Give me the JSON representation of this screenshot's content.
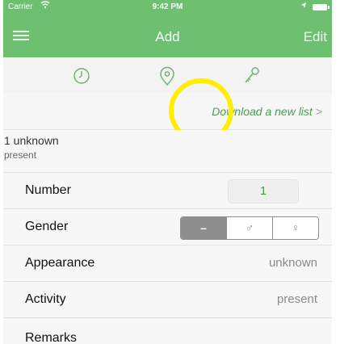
{
  "status_bar": {
    "carrier": "Carrier",
    "time": "9:42 PM"
  },
  "nav": {
    "title": "Add",
    "edit_label": "Edit",
    "menu_icon": "hamburger-menu-icon"
  },
  "tabs": [
    {
      "icon": "clock-icon"
    },
    {
      "icon": "location-pin-icon"
    },
    {
      "icon": "key-icon"
    }
  ],
  "download_link": {
    "label": "Download a new list",
    "chevron": ">"
  },
  "summary": {
    "line1": "1 unknown",
    "line2": "present"
  },
  "form": {
    "number": {
      "label": "Number",
      "value": "1"
    },
    "gender": {
      "label": "Gender",
      "options": [
        "–",
        "♂",
        "♀"
      ],
      "selected_index": 0
    },
    "appearance": {
      "label": "Appearance",
      "value": "unknown"
    },
    "activity": {
      "label": "Activity",
      "value": "present"
    },
    "remarks": {
      "label": "Remarks"
    }
  },
  "colors": {
    "accent": "#6cc06f",
    "highlight": "#ffee00"
  }
}
